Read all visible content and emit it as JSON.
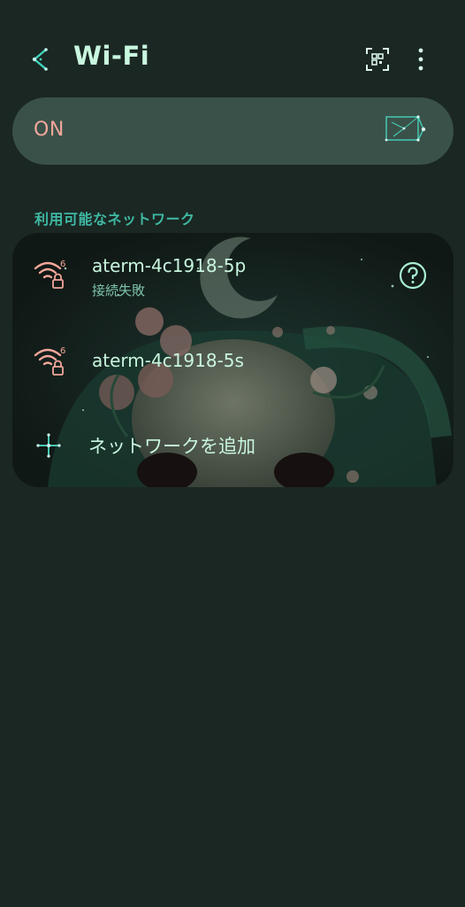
{
  "header": {
    "title": "Wi-Fi",
    "back_icon": "back-arrow-icon",
    "qr_icon": "qr-scan-icon",
    "more_icon": "more-vert-icon"
  },
  "toggle": {
    "label": "ON",
    "state": "on",
    "switch_icon": "constellation-toggle-icon"
  },
  "available": {
    "section_label": "利用可能なネットワーク",
    "networks": [
      {
        "name": "aterm-4c1918-5p",
        "status": "接続失敗",
        "icon": "wifi-6-locked-icon",
        "has_help": true,
        "help_icon": "help-circle-icon"
      },
      {
        "name": "aterm-4c1918-5s",
        "status": "",
        "icon": "wifi-6-locked-icon",
        "has_help": false
      }
    ],
    "add_network_label": "ネットワークを追加",
    "add_icon": "add-sparkle-icon"
  },
  "colors": {
    "background": "#1b2723",
    "accent": "#3fb9a4",
    "toggle_bg": "#3a5149",
    "on_text": "#f2a79a",
    "wifi_icon": "#f2a79a",
    "text_primary": "#c9f6df"
  }
}
